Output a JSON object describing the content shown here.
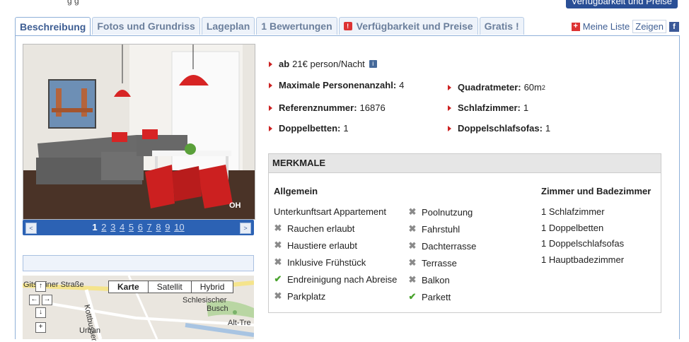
{
  "top": {
    "right_button": "Verfügbarkeit und Preise",
    "partial_text": "g g"
  },
  "tabs": [
    {
      "label": "Beschreibung",
      "active": true
    },
    {
      "label": "Fotos und Grundriss"
    },
    {
      "label": "Lageplan"
    },
    {
      "label": "1 Bewertungen"
    },
    {
      "label": "Verfügbarkeit und Preise",
      "icon": "calendar-icon"
    },
    {
      "label": "Gratis !"
    }
  ],
  "toolbar": {
    "my_list": "Meine Liste",
    "show": "Zeigen"
  },
  "gallery": {
    "watermark": "OH",
    "pages": [
      "1",
      "2",
      "3",
      "4",
      "5",
      "6",
      "7",
      "8",
      "9",
      "10"
    ],
    "current_page": "1",
    "prev": "<",
    "next": ">"
  },
  "map": {
    "types": [
      "Karte",
      "Satellit",
      "Hybrid"
    ],
    "selected": "Karte",
    "labels": {
      "street": "Gitschiner Straße",
      "park1": "Schlesischer",
      "park2": "Busch",
      "district": "Alt-Tre",
      "street2": "Kottbusser",
      "street3": "Urban"
    }
  },
  "details": {
    "price_label": "ab",
    "price_value": "21€ person/Nacht",
    "max_persons_label": "Maximale Personenanzahl:",
    "max_persons": "4",
    "area_label": "Quadratmeter:",
    "area_value": "60m",
    "area_sup": "2",
    "ref_label": "Referenznummer:",
    "ref_value": "16876",
    "bedrooms_label": "Schlafzimmer:",
    "bedrooms_value": "1",
    "double_beds_label": "Doppelbetten:",
    "double_beds_value": "1",
    "sofa_label": "Doppelschlafsofas:",
    "sofa_value": "1"
  },
  "features": {
    "title": "MERKMALE",
    "general_title": "Allgemein",
    "rooms_title": "Zimmer und Badezimmer",
    "type_text": "Unterkunftsart Appartement",
    "col1": [
      {
        "label": "Rauchen erlaubt",
        "available": false
      },
      {
        "label": "Haustiere erlaubt",
        "available": false
      },
      {
        "label": "Inklusive Frühstück",
        "available": false
      },
      {
        "label": "Endreinigung nach Abreise",
        "available": true
      },
      {
        "label": "Parkplatz",
        "available": false
      }
    ],
    "col2": [
      {
        "label": "Poolnutzung",
        "available": false
      },
      {
        "label": "Fahrstuhl",
        "available": false
      },
      {
        "label": "Dachterrasse",
        "available": false
      },
      {
        "label": "Terrasse",
        "available": false
      },
      {
        "label": "Balkon",
        "available": false
      },
      {
        "label": "Parkett",
        "available": true
      }
    ],
    "rooms": [
      "1 Schlafzimmer",
      "1 Doppelbetten",
      "1 Doppelschlafsofas",
      "1 Hauptbadezimmer"
    ]
  }
}
